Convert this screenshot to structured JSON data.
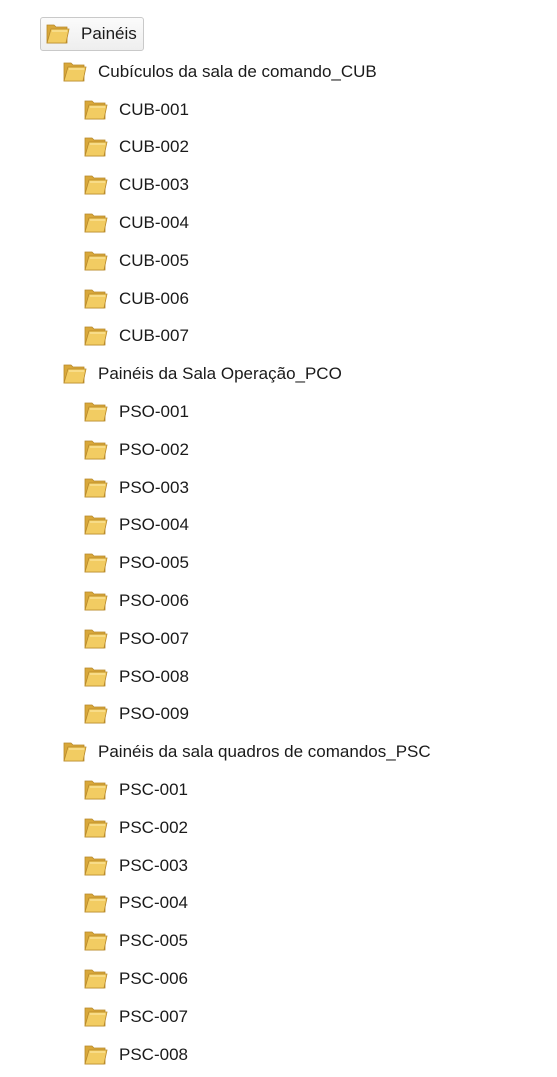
{
  "tree": {
    "root": {
      "label": "Painéis",
      "icon": "folder-icon"
    },
    "groups": [
      {
        "label": "Cubículos da sala de comando_CUB",
        "icon": "folder-icon",
        "children": [
          "CUB-001",
          "CUB-002",
          "CUB-003",
          "CUB-004",
          "CUB-005",
          "CUB-006",
          "CUB-007"
        ]
      },
      {
        "label": "Painéis da Sala Operação_PCO",
        "icon": "folder-icon",
        "children": [
          "PSO-001",
          "PSO-002",
          "PSO-003",
          "PSO-004",
          "PSO-005",
          "PSO-006",
          "PSO-007",
          "PSO-008",
          "PSO-009"
        ]
      },
      {
        "label": "Painéis da sala quadros de comandos_PSC",
        "icon": "folder-icon",
        "children": [
          "PSC-001",
          "PSC-002",
          "PSC-003",
          "PSC-004",
          "PSC-005",
          "PSC-006",
          "PSC-007",
          "PSC-008"
        ]
      }
    ]
  },
  "colors": {
    "folder_front": "#f2cc62",
    "folder_back": "#d9a83a",
    "folder_edge": "#b8892a",
    "text": "#1a1a1a"
  }
}
